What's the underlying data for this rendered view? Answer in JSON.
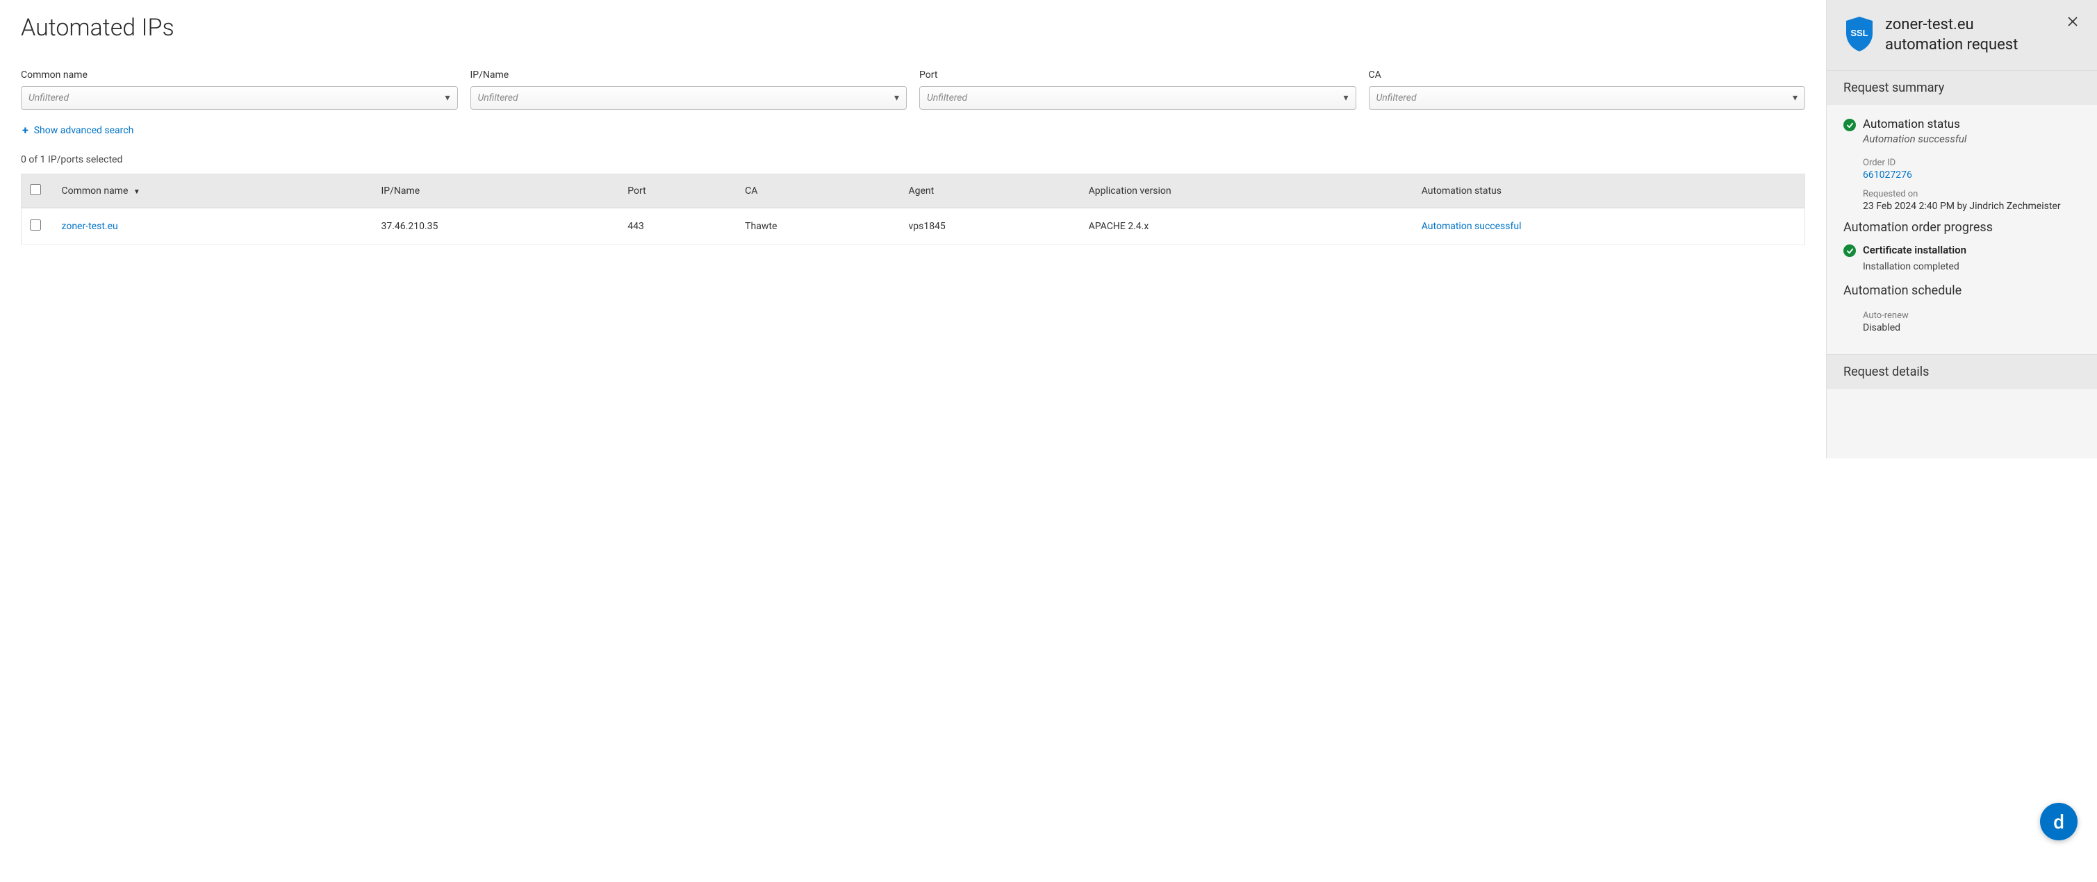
{
  "page": {
    "title": "Automated IPs",
    "selection_text": "0 of 1 IP/ports selected",
    "adv_search_label": "Show advanced search"
  },
  "filters": [
    {
      "label": "Common name",
      "placeholder": "Unfiltered"
    },
    {
      "label": "IP/Name",
      "placeholder": "Unfiltered"
    },
    {
      "label": "Port",
      "placeholder": "Unfiltered"
    },
    {
      "label": "CA",
      "placeholder": "Unfiltered"
    }
  ],
  "table": {
    "headers": {
      "common_name": "Common name",
      "ip_name": "IP/Name",
      "port": "Port",
      "ca": "CA",
      "agent": "Agent",
      "app_version": "Application version",
      "auto_status": "Automation status"
    },
    "rows": [
      {
        "common_name": "zoner-test.eu",
        "ip_name": "37.46.210.35",
        "port": "443",
        "ca": "Thawte",
        "agent": "vps1845",
        "app_version": "APACHE 2.4.x",
        "auto_status": "Automation successful"
      }
    ]
  },
  "panel": {
    "title_line1": "zoner-test.eu",
    "title_line2": "automation request",
    "section_summary": "Request summary",
    "status_title": "Automation status",
    "status_sub": "Automation successful",
    "order_id_label": "Order ID",
    "order_id": "661027276",
    "requested_label": "Requested on",
    "requested_on": "23 Feb 2024 2:40 PM by Jindrich Zechmeister",
    "progress_heading": "Automation order progress",
    "install_title": "Certificate installation",
    "install_sub": "Installation completed",
    "schedule_heading": "Automation schedule",
    "autorenew_label": "Auto-renew",
    "autorenew_value": "Disabled",
    "section_details": "Request details"
  },
  "fab": {
    "letter": "d"
  }
}
